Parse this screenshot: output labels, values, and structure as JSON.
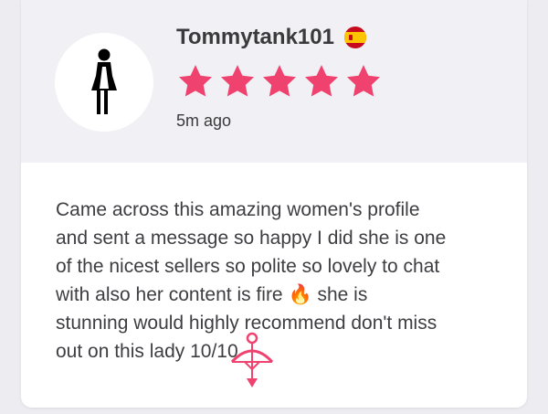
{
  "review": {
    "username": "Tommytank101",
    "country_flag": "spain-flag-icon",
    "rating": 5,
    "rating_max": 5,
    "time_ago": "5m ago",
    "lines": [
      "Came across this amazing women's profile",
      "and sent a message so happy I did she is one",
      "of the nicest sellers so polite so lovely to chat",
      "with also her content is fire",
      "she is",
      "stunning would highly recommend don't miss",
      "out on this lady 10/10"
    ],
    "emoji": "🔥"
  },
  "colors": {
    "star": "#f0426f",
    "header_bg": "#f1f1f5",
    "watermark": "#f0426f"
  }
}
